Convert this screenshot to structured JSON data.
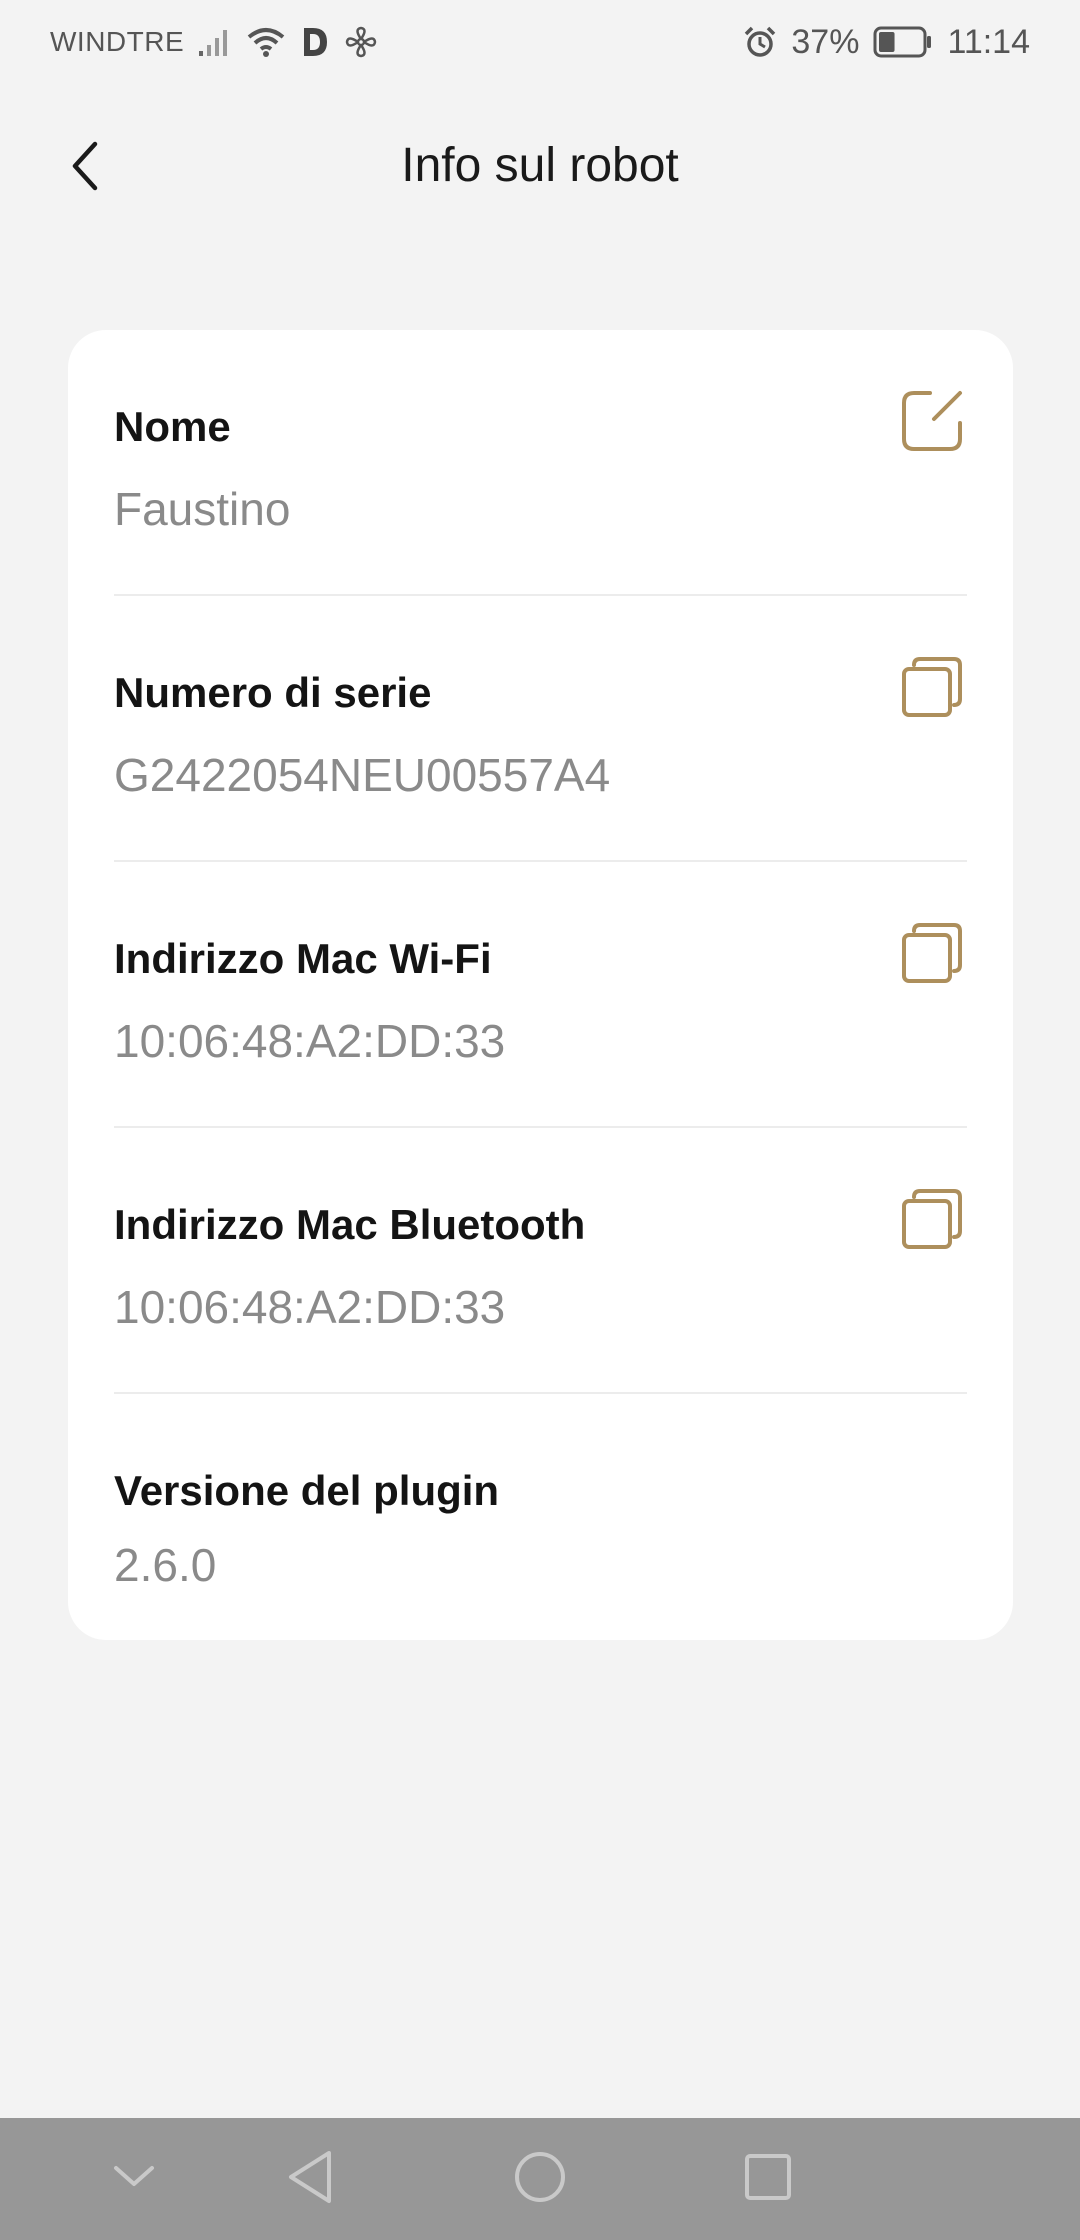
{
  "status_bar": {
    "carrier": "WINDTRE",
    "battery_percent": "37%",
    "battery_level": 0.37,
    "time": "11:14",
    "icons": [
      "signal-icon",
      "wifi-icon",
      "d-app-icon",
      "fan-icon",
      "alarm-icon",
      "battery-icon"
    ]
  },
  "header": {
    "title": "Info sul robot",
    "back_icon": "chevron-left-icon"
  },
  "rows": [
    {
      "label": "Nome",
      "value": "Faustino",
      "action_icon": "edit-icon"
    },
    {
      "label": "Numero di serie",
      "value": "G2422054NEU00557A4",
      "action_icon": "copy-icon"
    },
    {
      "label": "Indirizzo Mac Wi-Fi",
      "value": "10:06:48:A2:DD:33",
      "action_icon": "copy-icon"
    },
    {
      "label": "Indirizzo Mac Bluetooth",
      "value": "10:06:48:A2:DD:33",
      "action_icon": "copy-icon"
    },
    {
      "label": "Versione del plugin",
      "value": "2.6.0"
    }
  ],
  "colors": {
    "accent": "#ad8f5c",
    "background": "#f3f3f3",
    "card": "#ffffff",
    "navbar": "#979797"
  }
}
